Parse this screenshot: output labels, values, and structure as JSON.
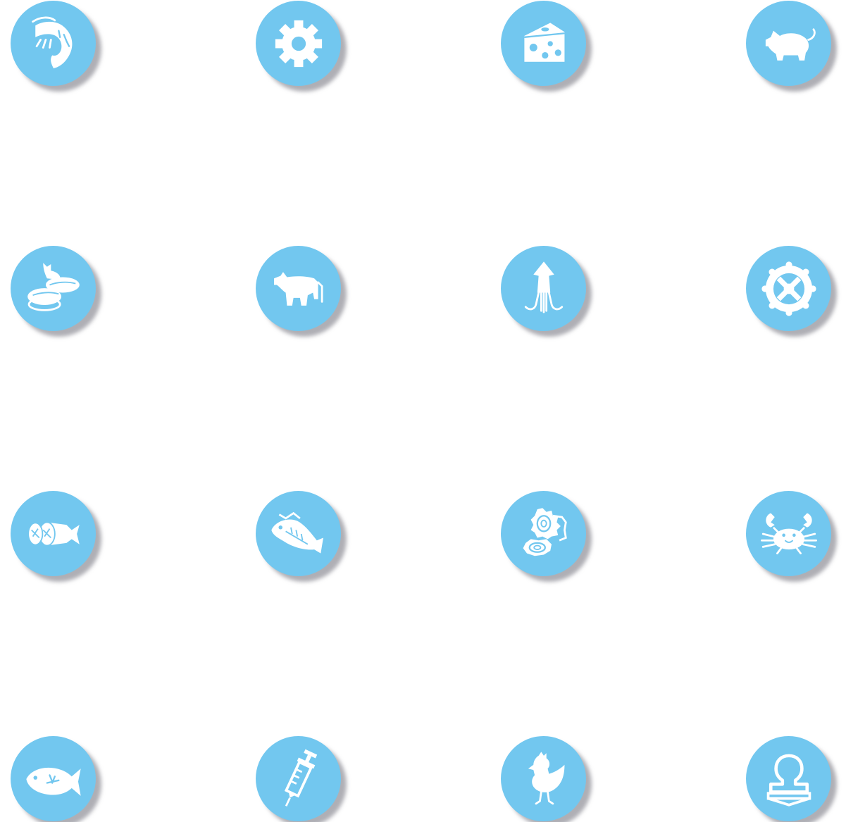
{
  "icons": [
    {
      "name": "shrimp-icon"
    },
    {
      "name": "gear-icon"
    },
    {
      "name": "cheese-icon"
    },
    {
      "name": "pig-icon"
    },
    {
      "name": "sushi-icon"
    },
    {
      "name": "cow-icon"
    },
    {
      "name": "squid-icon"
    },
    {
      "name": "wheel-icon"
    },
    {
      "name": "sliced-fish-icon"
    },
    {
      "name": "dried-fish-icon"
    },
    {
      "name": "oyster-icon"
    },
    {
      "name": "crab-icon"
    },
    {
      "name": "fish-icon"
    },
    {
      "name": "syringe-icon"
    },
    {
      "name": "chicken-icon"
    },
    {
      "name": "stamp-icon"
    }
  ],
  "colors": {
    "circle": "#72c7ef",
    "glyph": "#ffffff",
    "background": "#ffffff"
  }
}
